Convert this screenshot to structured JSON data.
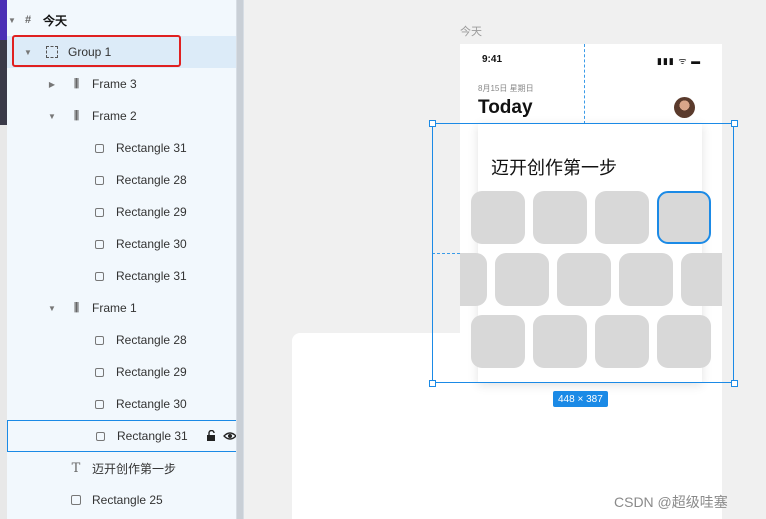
{
  "layers": {
    "page": {
      "label": "今天"
    },
    "group": {
      "label": "Group 1"
    },
    "frame3": {
      "label": "Frame 3"
    },
    "frame2": {
      "label": "Frame 2"
    },
    "frame2_children": [
      "Rectangle 31",
      "Rectangle 28",
      "Rectangle 29",
      "Rectangle 30",
      "Rectangle 31"
    ],
    "frame1": {
      "label": "Frame 1"
    },
    "frame1_children": [
      "Rectangle 28",
      "Rectangle 29",
      "Rectangle 30",
      "Rectangle 31"
    ],
    "text_layer": {
      "label": "迈开创作第一步"
    },
    "rect25": {
      "label": "Rectangle 25"
    }
  },
  "canvas": {
    "frame_title": "今天",
    "status_time": "9:41",
    "status_icons": "▮▮▮ ᯤ ▬",
    "date_label": "8月15日 星期日",
    "heading": "Today",
    "card_title": "迈开创作第一步",
    "size_badge": "448 × 387"
  },
  "watermark": "CSDN @超级哇塞",
  "colors": {
    "selection": "#1b8ae6",
    "highlight": "#e02020",
    "tile": "#d8d8d8"
  }
}
